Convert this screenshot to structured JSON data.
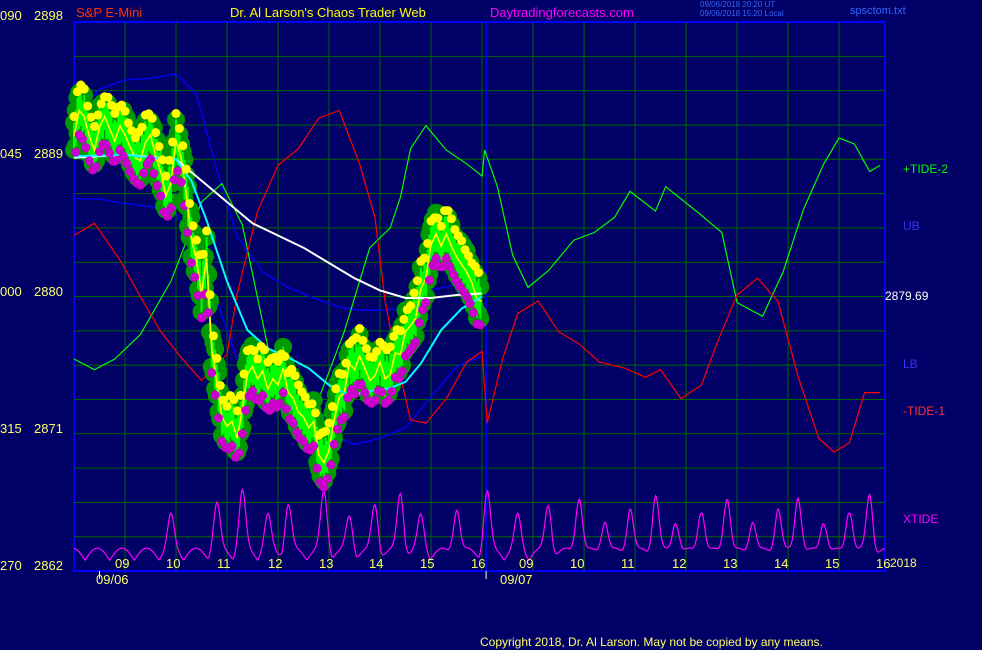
{
  "header": {
    "symbol": "S&P E-Mini",
    "author": "Dr. Al Larson's Chaos Trader Web",
    "site": "Daytradingforecasts.com",
    "stamp_ut": "09/06/2018 20:20 UT",
    "stamp_local": "09/06/2018 15:20 Local",
    "file": "spsctom.txt"
  },
  "colors": {
    "background": "#000066",
    "frame": "#0000ff",
    "grid": "#006600",
    "price_bars": "#00ff00",
    "close_line": "#ffff00",
    "slow_avg": "#ffffff",
    "fast_avg": "#00ffff",
    "tide_plus_2": "#00ff00",
    "tide_minus_1": "#ff0000",
    "bands": "#0000ff",
    "xtide": "#ff00ff",
    "highs": "#ffff00",
    "lows": "#cc00cc",
    "halo": "#009900"
  },
  "right_labels": {
    "tide_plus_2": "+TIDE-2",
    "ub": "UB",
    "last_price": "2879.69",
    "lb": "LB",
    "tide_minus_1": "-TIDE-1",
    "xtide": "XTIDE",
    "year": "2018"
  },
  "footer": {
    "copyright": "Copyright 2018, Dr. Al Larson. May not be copied by any means."
  },
  "chart_data": {
    "type": "line",
    "title": "S&P E-Mini",
    "y_axis": {
      "range": [
        2862,
        2898
      ],
      "ticks": [
        {
          "value": 2898,
          "index": "090",
          "label": "2898"
        },
        {
          "value": 2889,
          "index": "045",
          "label": "2889"
        },
        {
          "value": 2880,
          "index": "000",
          "label": "2880"
        },
        {
          "value": 2871,
          "index": "315",
          "label": "2871"
        },
        {
          "value": 2862,
          "index": "270",
          "label": "2862"
        }
      ]
    },
    "x_axis": {
      "range": [
        8,
        23.9
      ],
      "hour_ticks": [
        {
          "x": 9,
          "label": "09"
        },
        {
          "x": 10,
          "label": "10"
        },
        {
          "x": 11,
          "label": "11"
        },
        {
          "x": 12,
          "label": "12"
        },
        {
          "x": 13,
          "label": "13"
        },
        {
          "x": 14,
          "label": "14"
        },
        {
          "x": 15,
          "label": "15"
        },
        {
          "x": 16,
          "label": "16"
        },
        {
          "x": 17,
          "label": "09"
        },
        {
          "x": 18,
          "label": "10"
        },
        {
          "x": 19,
          "label": "11"
        },
        {
          "x": 20,
          "label": "12"
        },
        {
          "x": 21,
          "label": "13"
        },
        {
          "x": 22,
          "label": "14"
        },
        {
          "x": 23,
          "label": "15"
        },
        {
          "x": 24,
          "label": "16"
        }
      ],
      "date_labels": [
        {
          "x": 8.5,
          "label": "09/06"
        },
        {
          "x": 16.7,
          "label": "09/07"
        }
      ],
      "day_divider": 16.08
    },
    "last_price": 2879.69,
    "series": [
      {
        "name": "price",
        "points": [
          [
            8,
            2890.5
          ],
          [
            8.1,
            2892.2
          ],
          [
            8.2,
            2891.8
          ],
          [
            8.3,
            2890.5
          ],
          [
            8.4,
            2889.6
          ],
          [
            8.5,
            2891.1
          ],
          [
            8.6,
            2891.8
          ],
          [
            8.7,
            2891
          ],
          [
            8.8,
            2890.2
          ],
          [
            8.9,
            2891.2
          ],
          [
            9,
            2890.6
          ],
          [
            9.1,
            2889.8
          ],
          [
            9.2,
            2889.1
          ],
          [
            9.3,
            2888.9
          ],
          [
            9.4,
            2890.1
          ],
          [
            9.5,
            2890.6
          ],
          [
            9.6,
            2889.2
          ],
          [
            9.7,
            2888.2
          ],
          [
            9.8,
            2886.6
          ],
          [
            9.9,
            2887.4
          ],
          [
            10,
            2890.2
          ],
          [
            10.1,
            2889.1
          ],
          [
            10.2,
            2886.8
          ],
          [
            10.3,
            2883.8
          ],
          [
            10.4,
            2882.4
          ],
          [
            10.5,
            2880.2
          ],
          [
            10.6,
            2882.5
          ],
          [
            10.7,
            2876.6
          ],
          [
            10.8,
            2874.4
          ],
          [
            10.9,
            2872.1
          ],
          [
            11,
            2871.5
          ],
          [
            11.1,
            2871.8
          ],
          [
            11.2,
            2870.7
          ],
          [
            11.3,
            2872.6
          ],
          [
            11.4,
            2874.9
          ],
          [
            11.5,
            2875.4
          ],
          [
            11.6,
            2874.6
          ],
          [
            11.7,
            2875.1
          ],
          [
            11.8,
            2873.9
          ],
          [
            11.9,
            2874.6
          ],
          [
            12,
            2874.2
          ],
          [
            12.1,
            2875.3
          ],
          [
            12.2,
            2873.7
          ],
          [
            12.3,
            2873.3
          ],
          [
            12.4,
            2872.4
          ],
          [
            12.5,
            2872.1
          ],
          [
            12.6,
            2871.4
          ],
          [
            12.7,
            2871.8
          ],
          [
            12.8,
            2869.6
          ],
          [
            12.9,
            2869.1
          ],
          [
            13,
            2869.9
          ],
          [
            13.1,
            2871.9
          ],
          [
            13.2,
            2873.4
          ],
          [
            13.3,
            2873.7
          ],
          [
            13.4,
            2875.6
          ],
          [
            13.5,
            2875.2
          ],
          [
            13.6,
            2876.1
          ],
          [
            13.7,
            2875.3
          ],
          [
            13.8,
            2874.5
          ],
          [
            13.9,
            2874.8
          ],
          [
            14,
            2875.7
          ],
          [
            14.1,
            2874.6
          ],
          [
            14.2,
            2874.9
          ],
          [
            14.3,
            2876.3
          ],
          [
            14.4,
            2876.2
          ],
          [
            14.5,
            2877.7
          ],
          [
            14.6,
            2878.1
          ],
          [
            14.7,
            2878.6
          ],
          [
            14.8,
            2880.5
          ],
          [
            14.9,
            2881.2
          ],
          [
            15,
            2883.4
          ],
          [
            15.1,
            2884.1
          ],
          [
            15.2,
            2883.3
          ],
          [
            15.3,
            2884.1
          ],
          [
            15.4,
            2883.3
          ],
          [
            15.5,
            2882.6
          ],
          [
            15.6,
            2882.1
          ],
          [
            15.7,
            2881.6
          ],
          [
            15.8,
            2880.9
          ],
          [
            15.9,
            2879.8
          ],
          [
            16,
            2879.7
          ]
        ]
      },
      {
        "name": "fast_avg",
        "points": [
          [
            8,
            2889.2
          ],
          [
            9,
            2889.3
          ],
          [
            9.5,
            2889.1
          ],
          [
            10,
            2889
          ],
          [
            10.3,
            2887.6
          ],
          [
            10.6,
            2885
          ],
          [
            11,
            2881
          ],
          [
            11.4,
            2877.8
          ],
          [
            11.8,
            2876.6
          ],
          [
            12.2,
            2876
          ],
          [
            12.6,
            2875.3
          ],
          [
            13,
            2874.2
          ],
          [
            13.4,
            2873.5
          ],
          [
            13.8,
            2873.8
          ],
          [
            14.2,
            2874
          ],
          [
            14.5,
            2874.4
          ],
          [
            14.8,
            2875.6
          ],
          [
            15.2,
            2877.8
          ],
          [
            15.6,
            2879.2
          ],
          [
            16,
            2880
          ]
        ]
      },
      {
        "name": "slow_avg",
        "points": [
          [
            8,
            2889.1
          ],
          [
            9,
            2889.3
          ],
          [
            10,
            2889
          ],
          [
            10.5,
            2887.6
          ],
          [
            11,
            2886.2
          ],
          [
            11.5,
            2884.8
          ],
          [
            12,
            2884
          ],
          [
            12.5,
            2883.2
          ],
          [
            13,
            2882.2
          ],
          [
            13.5,
            2881.2
          ],
          [
            14,
            2880.4
          ],
          [
            14.5,
            2879.9
          ],
          [
            15,
            2879.9
          ],
          [
            15.5,
            2880.1
          ],
          [
            16,
            2880.2
          ]
        ]
      },
      {
        "name": "+TIDE-2",
        "points": [
          [
            8,
            2875.9
          ],
          [
            8.4,
            2875.2
          ],
          [
            8.8,
            2875.9
          ],
          [
            9.3,
            2877.5
          ],
          [
            9.9,
            2881
          ],
          [
            10.5,
            2886.2
          ],
          [
            10.9,
            2887.4
          ],
          [
            11.3,
            2884.7
          ],
          [
            11.8,
            2876.7
          ],
          [
            12.3,
            2873.4
          ],
          [
            12.8,
            2873.3
          ],
          [
            13.3,
            2877.7
          ],
          [
            13.8,
            2883.2
          ],
          [
            14.2,
            2884.5
          ],
          [
            14.4,
            2886.5
          ],
          [
            14.6,
            2889.7
          ],
          [
            14.9,
            2891.2
          ],
          [
            15.3,
            2889.6
          ],
          [
            15.7,
            2888.7
          ],
          [
            16,
            2887.9
          ],
          [
            16.05,
            2889.6
          ],
          [
            16.3,
            2887.2
          ],
          [
            16.6,
            2882.7
          ],
          [
            16.9,
            2880.6
          ],
          [
            17.3,
            2881.7
          ],
          [
            17.8,
            2883.7
          ],
          [
            18.2,
            2884.2
          ],
          [
            18.6,
            2885.2
          ],
          [
            18.9,
            2886.9
          ],
          [
            19.4,
            2885.6
          ],
          [
            19.6,
            2887.2
          ],
          [
            20.2,
            2885.6
          ],
          [
            20.7,
            2884.2
          ],
          [
            21,
            2879.6
          ],
          [
            21.5,
            2878.7
          ],
          [
            21.9,
            2881.6
          ],
          [
            22.3,
            2885.7
          ],
          [
            22.7,
            2888.7
          ],
          [
            23,
            2890.4
          ],
          [
            23.3,
            2890
          ],
          [
            23.6,
            2888.2
          ],
          [
            23.8,
            2888.6
          ]
        ]
      },
      {
        "name": "-TIDE-1",
        "points": [
          [
            8,
            2884
          ],
          [
            8.4,
            2884.8
          ],
          [
            8.9,
            2882.4
          ],
          [
            9.3,
            2880
          ],
          [
            9.7,
            2877.7
          ],
          [
            10.1,
            2876
          ],
          [
            10.5,
            2874.5
          ],
          [
            11,
            2876.2
          ],
          [
            11.2,
            2880.2
          ],
          [
            11.6,
            2885.6
          ],
          [
            12,
            2888.6
          ],
          [
            12.4,
            2889.7
          ],
          [
            12.8,
            2891.7
          ],
          [
            13.2,
            2892.2
          ],
          [
            13.6,
            2888.7
          ],
          [
            13.9,
            2885.2
          ],
          [
            14.1,
            2879.7
          ],
          [
            14.3,
            2876.2
          ],
          [
            14.6,
            2871.9
          ],
          [
            14.9,
            2871.7
          ],
          [
            15.3,
            2873.3
          ],
          [
            15.7,
            2875.7
          ],
          [
            16,
            2876.4
          ],
          [
            16.1,
            2871.7
          ],
          [
            16.4,
            2875.9
          ],
          [
            16.7,
            2878.9
          ],
          [
            17.1,
            2879.7
          ],
          [
            17.5,
            2877.7
          ],
          [
            17.9,
            2876.9
          ],
          [
            18.3,
            2875.7
          ],
          [
            18.8,
            2875.3
          ],
          [
            19.2,
            2874.7
          ],
          [
            19.5,
            2875.2
          ],
          [
            19.9,
            2873.3
          ],
          [
            20.3,
            2874.2
          ],
          [
            20.6,
            2876.9
          ],
          [
            21,
            2880.1
          ],
          [
            21.4,
            2881.2
          ],
          [
            21.8,
            2879.7
          ],
          [
            22.2,
            2874.7
          ],
          [
            22.6,
            2870.7
          ],
          [
            22.9,
            2869.8
          ],
          [
            23.2,
            2870.4
          ],
          [
            23.5,
            2873.7
          ],
          [
            23.8,
            2873.7
          ]
        ]
      },
      {
        "name": "UB",
        "points": [
          [
            8,
            2891.5
          ],
          [
            8.5,
            2893.6
          ],
          [
            9,
            2894.2
          ],
          [
            9.5,
            2894.3
          ],
          [
            10,
            2894.6
          ],
          [
            10.4,
            2893.3
          ],
          [
            10.8,
            2888.3
          ],
          [
            11.2,
            2883.9
          ],
          [
            11.7,
            2881.6
          ],
          [
            12.2,
            2880.6
          ],
          [
            12.7,
            2879.9
          ],
          [
            13.2,
            2879.3
          ],
          [
            13.6,
            2879.1
          ],
          [
            14,
            2879.1
          ],
          [
            14.5,
            2879.2
          ],
          [
            15,
            2880.4
          ],
          [
            15.5,
            2880.8
          ],
          [
            16,
            2880.3
          ]
        ]
      },
      {
        "name": "LB",
        "points": [
          [
            8,
            2886.4
          ],
          [
            8.5,
            2886.4
          ],
          [
            9,
            2886.1
          ],
          [
            9.5,
            2885.9
          ],
          [
            10,
            2885.4
          ],
          [
            10.4,
            2883.4
          ],
          [
            10.8,
            2879.7
          ],
          [
            11.2,
            2875.9
          ],
          [
            11.6,
            2874
          ],
          [
            12,
            2873.3
          ],
          [
            12.5,
            2872.2
          ],
          [
            13,
            2871
          ],
          [
            13.5,
            2870.3
          ],
          [
            14,
            2870.7
          ],
          [
            14.5,
            2871.4
          ],
          [
            15,
            2873.4
          ],
          [
            15.5,
            2875.4
          ],
          [
            16,
            2876.1
          ]
        ]
      }
    ]
  }
}
